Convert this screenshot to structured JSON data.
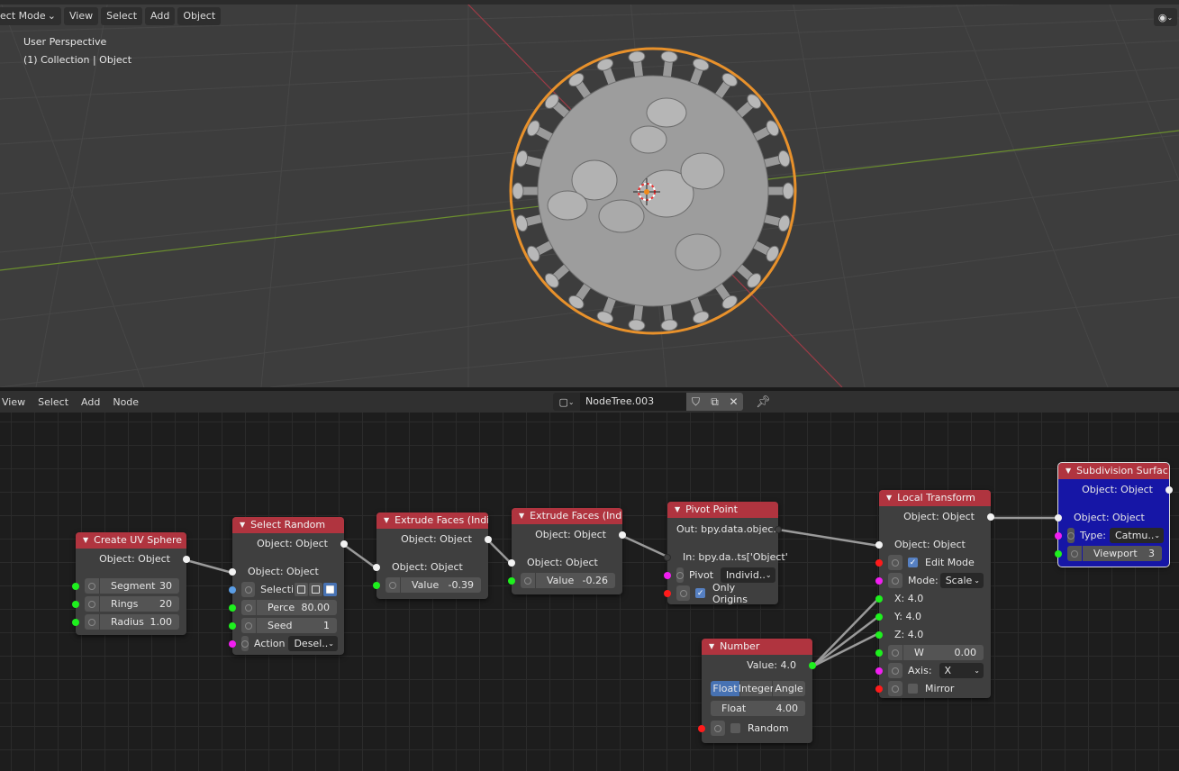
{
  "viewport": {
    "mode_label": "ect Mode",
    "menus": [
      "View",
      "Select",
      "Add",
      "Object"
    ],
    "perspective_label": "User Perspective",
    "collection_label": "(1) Collection | Object",
    "overlay_icon": "visibility-eye-icon",
    "colors": {
      "background": "#3d3d3d",
      "x_axis": "#9c3b46",
      "y_axis": "#6b8f2e",
      "selection_outline": "#e8912b"
    }
  },
  "node_editor": {
    "menus": [
      "View",
      "Select",
      "Add",
      "Node"
    ],
    "tree_name": "NodeTree.003",
    "icons": [
      "node-tree-type-icon",
      "fake-user-shield-icon",
      "duplicate-icon",
      "unlink-x-icon",
      "pin-icon"
    ],
    "nodes": {
      "create_uv_sphere": {
        "title": "Create UV Sphere",
        "output": "Object: Object",
        "segment_label": "Segment",
        "segment_value": "30",
        "rings_label": "Rings",
        "rings_value": "20",
        "radius_label": "Radius",
        "radius_value": "1.00"
      },
      "select_random": {
        "title": "Select Random",
        "output": "Object: Object",
        "input": "Object: Object",
        "selection_label": "Selecti",
        "percent_label": "Perce",
        "percent_value": "80.00",
        "seed_label": "Seed",
        "seed_value": "1",
        "action_label": "Action",
        "action_value": "Desel.."
      },
      "extrude_1": {
        "title": "Extrude Faces (Indi..",
        "output": "Object: Object",
        "input": "Object: Object",
        "value_label": "Value",
        "value": "-0.39"
      },
      "extrude_2": {
        "title": "Extrude Faces (Indi..",
        "output": "Object: Object",
        "input": "Object: Object",
        "value_label": "Value",
        "value": "-0.26"
      },
      "pivot_point": {
        "title": "Pivot Point",
        "output": "Out: bpy.data.objec..",
        "input": "In: bpy.da..ts['Object'",
        "pivot_label": "Pivot",
        "pivot_value": "Individ..",
        "only_origins_label": "Only Origins",
        "only_origins_checked": true
      },
      "local_transform": {
        "title": "Local Transform",
        "output": "Object: Object",
        "input": "Object: Object",
        "edit_mode_label": "Edit Mode",
        "edit_mode_checked": true,
        "mode_label": "Mode:",
        "mode_value": "Scale",
        "x_label": "X: 4.0",
        "y_label": "Y: 4.0",
        "z_label": "Z: 4.0",
        "w_label": "W",
        "w_value": "0.00",
        "axis_label": "Axis:",
        "axis_value": "X",
        "mirror_label": "Mirror",
        "mirror_checked": false
      },
      "subdivision_surface": {
        "title": "Subdivision Surfac..",
        "output": "Object: Object",
        "input": "Object: Object",
        "type_label": "Type:",
        "type_value": "Catmu..",
        "viewport_label": "Viewport",
        "viewport_value": "3"
      },
      "number": {
        "title": "Number",
        "output": "Value: 4.0",
        "modes": [
          "Float",
          "Integer",
          "Angle"
        ],
        "active_mode": "Float",
        "float_label": "Float",
        "float_value": "4.00",
        "random_label": "Random",
        "random_checked": false
      }
    },
    "colors": {
      "header_red": "#b0343f",
      "active_node_blue": "#1616a6",
      "socket_object": "#f2f2f2",
      "socket_float": "#1ef01e",
      "socket_bool": "#ff1b1b",
      "socket_enum": "#f21ef2",
      "socket_selection": "#5b9ee6"
    }
  }
}
